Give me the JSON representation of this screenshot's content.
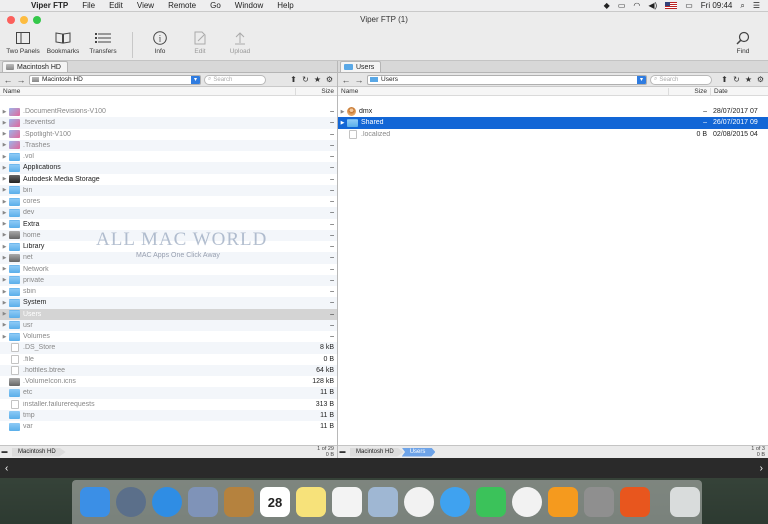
{
  "menubar": {
    "items": [
      "Viper FTP",
      "File",
      "Edit",
      "View",
      "Remote",
      "Go",
      "Window",
      "Help"
    ],
    "clock": "Fri 09:44"
  },
  "window": {
    "title": "Viper FTP (1)"
  },
  "toolbar": {
    "two_panels": "Two Panels",
    "bookmarks": "Bookmarks",
    "transfers": "Transfers",
    "info": "Info",
    "edit": "Edit",
    "upload": "Upload",
    "find": "Find"
  },
  "left_pane": {
    "tab": "Macintosh HD",
    "path": "Macintosh HD",
    "search_placeholder": "Search",
    "columns": {
      "name": "Name",
      "size": "Size"
    },
    "rows": [
      {
        "name": ".DocumentRevisions-V100",
        "size": "–",
        "icon": "sys",
        "dim": true
      },
      {
        "name": ".fseventsd",
        "size": "–",
        "icon": "sys",
        "dim": true
      },
      {
        "name": ".Spotlight-V100",
        "size": "–",
        "icon": "sys",
        "dim": true
      },
      {
        "name": ".Trashes",
        "size": "–",
        "icon": "sys",
        "dim": true
      },
      {
        "name": ".vol",
        "size": "–",
        "icon": "folder",
        "dim": true
      },
      {
        "name": "Applications",
        "size": "–",
        "icon": "folder",
        "dim": false
      },
      {
        "name": "Autodesk Media Storage",
        "size": "–",
        "icon": "drive",
        "dim": false
      },
      {
        "name": "bin",
        "size": "–",
        "icon": "folder",
        "dim": true
      },
      {
        "name": "cores",
        "size": "–",
        "icon": "folder",
        "dim": true
      },
      {
        "name": "dev",
        "size": "–",
        "icon": "folder",
        "dim": true
      },
      {
        "name": "Extra",
        "size": "–",
        "icon": "folder",
        "dim": false
      },
      {
        "name": "home",
        "size": "–",
        "icon": "drivegray",
        "dim": true
      },
      {
        "name": "Library",
        "size": "–",
        "icon": "folder",
        "dim": false
      },
      {
        "name": "net",
        "size": "–",
        "icon": "drivegray",
        "dim": true
      },
      {
        "name": "Network",
        "size": "–",
        "icon": "folder",
        "dim": true
      },
      {
        "name": "private",
        "size": "–",
        "icon": "folder",
        "dim": true
      },
      {
        "name": "sbin",
        "size": "–",
        "icon": "folder",
        "dim": true
      },
      {
        "name": "System",
        "size": "–",
        "icon": "folder",
        "dim": false
      },
      {
        "name": "Users",
        "size": "–",
        "icon": "folder",
        "dim": false,
        "highlight": true
      },
      {
        "name": "usr",
        "size": "–",
        "icon": "folder",
        "dim": true
      },
      {
        "name": "Volumes",
        "size": "–",
        "icon": "folder",
        "dim": true
      },
      {
        "name": ".DS_Store",
        "size": "8 kB",
        "icon": "doc",
        "dim": true
      },
      {
        "name": ".file",
        "size": "0 B",
        "icon": "doc",
        "dim": true
      },
      {
        "name": ".hotfiles.btree",
        "size": "64 kB",
        "icon": "doc",
        "dim": true
      },
      {
        "name": ".VolumeIcon.icns",
        "size": "128 kB",
        "icon": "drivegray",
        "dim": true
      },
      {
        "name": "etc",
        "size": "11 B",
        "icon": "link",
        "dim": true
      },
      {
        "name": "installer.failurerequests",
        "size": "313 B",
        "icon": "doc",
        "dim": true
      },
      {
        "name": "tmp",
        "size": "11 B",
        "icon": "link",
        "dim": true
      },
      {
        "name": "var",
        "size": "11 B",
        "icon": "link",
        "dim": true
      }
    ],
    "status_crumb": "Macintosh HD",
    "status_count": "1 of 29",
    "status_size": "0 B"
  },
  "watermark": {
    "title": "ALL MAC WORLD",
    "subtitle": "MAC Apps One Click Away"
  },
  "right_pane": {
    "tab": "Users",
    "path": "Users",
    "search_placeholder": "Search",
    "columns": {
      "name": "Name",
      "size": "Size",
      "date": "Date"
    },
    "rows": [
      {
        "name": "dmx",
        "size": "–",
        "date": "28/07/2017 07",
        "icon": "user",
        "dim": false,
        "selected": false
      },
      {
        "name": "Shared",
        "size": "–",
        "date": "26/07/2017 09",
        "icon": "folder",
        "dim": false,
        "selected": true
      },
      {
        "name": ".localized",
        "size": "0 B",
        "date": "02/08/2015 04",
        "icon": "doc",
        "dim": true,
        "selected": false
      }
    ],
    "status_crumbs": [
      "Macintosh HD",
      "Users"
    ],
    "status_count": "1 of 3",
    "status_size": "0 B"
  },
  "dock": {
    "icons": [
      {
        "name": "finder",
        "color": "#3b8fe6"
      },
      {
        "name": "launchpad",
        "color": "#5b6f8a"
      },
      {
        "name": "safari",
        "color": "#2f8de4"
      },
      {
        "name": "mail-stamp",
        "color": "#7f93b8"
      },
      {
        "name": "contacts",
        "color": "#b5823e"
      },
      {
        "name": "calendar",
        "color": "#ffffff",
        "text": "28"
      },
      {
        "name": "notes",
        "color": "#f7e27a"
      },
      {
        "name": "reminders",
        "color": "#f3f3f3"
      },
      {
        "name": "preview",
        "color": "#9fb7d3"
      },
      {
        "name": "photos",
        "color": "#f2f2f2"
      },
      {
        "name": "messages",
        "color": "#3fa2f0"
      },
      {
        "name": "facetime",
        "color": "#3bc25a"
      },
      {
        "name": "itunes",
        "color": "#f2f2f2"
      },
      {
        "name": "ibooks",
        "color": "#f59a1e"
      },
      {
        "name": "system-preferences",
        "color": "#8f8f8f"
      },
      {
        "name": "viper-ftp",
        "color": "#e8561e"
      },
      {
        "name": "trash",
        "color": "#d9dcdc"
      }
    ]
  }
}
